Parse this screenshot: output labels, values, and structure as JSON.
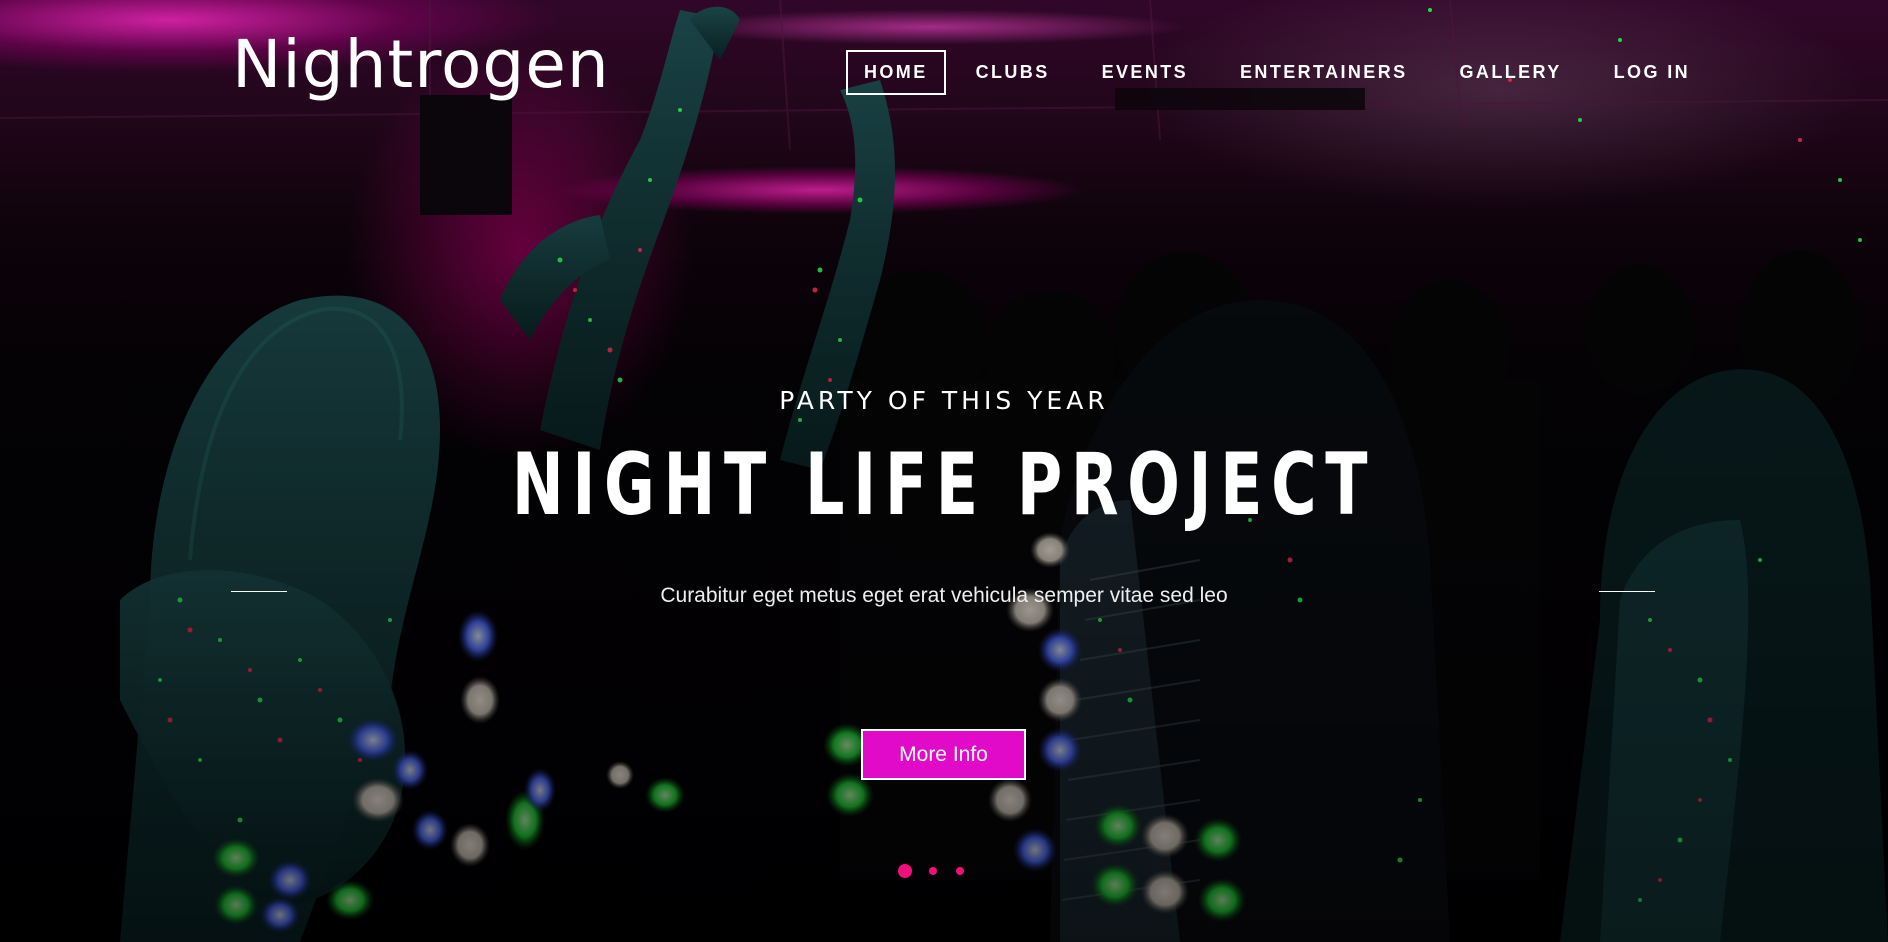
{
  "brand": {
    "name": "Nightrogen"
  },
  "nav": {
    "items": [
      {
        "label": "HOME",
        "active": true
      },
      {
        "label": "CLUBS",
        "active": false
      },
      {
        "label": "EVENTS",
        "active": false
      },
      {
        "label": "ENTERTAINERS",
        "active": false
      },
      {
        "label": "GALLERY",
        "active": false
      },
      {
        "label": "LOG IN",
        "active": false
      }
    ]
  },
  "hero": {
    "kicker": "PARTY OF THIS YEAR",
    "headline": "NIGHT LIFE PROJECT",
    "tagline": "Curabitur eget metus eget erat vehicula semper vitae sed leo",
    "cta_label": "More Info",
    "background_image": "nightclub-dance-floor-photo"
  },
  "slider": {
    "slide_count": 3,
    "active_index": 0
  },
  "colors": {
    "accent": "#e10ac9",
    "dot_color": "#f0107a",
    "text": "#ffffff",
    "ceiling_glow": "#ff28c8",
    "laser_green": "#33ff55",
    "laser_red": "#ff3355"
  }
}
